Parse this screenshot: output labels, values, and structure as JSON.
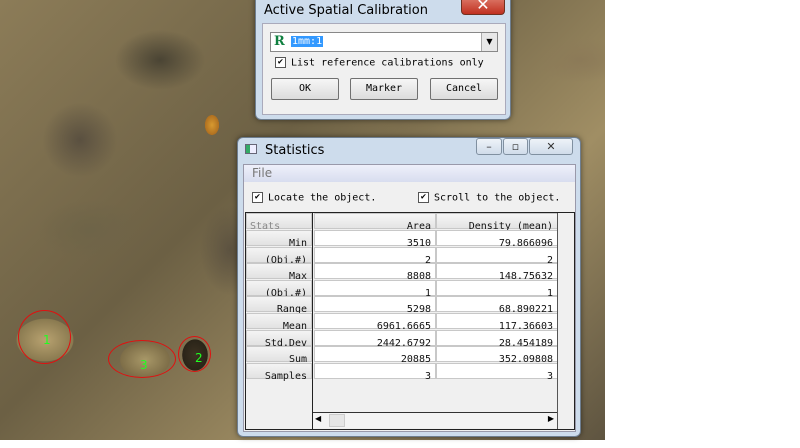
{
  "image": {
    "labels": [
      "1",
      "2",
      "3"
    ]
  },
  "calibration": {
    "title": "Active Spatial Calibration",
    "close_icon": "close-icon",
    "badge": "R",
    "selected": "1mm:1",
    "checkbox_label": "List reference calibrations only",
    "checked": true,
    "ok": "OK",
    "marker": "Marker",
    "cancel": "Cancel"
  },
  "statistics": {
    "title": "Statistics",
    "menu": [
      "File"
    ],
    "locate_label": "Locate the object.",
    "locate_checked": true,
    "scroll_label": "Scroll to the object.",
    "scroll_checked": true,
    "headers": [
      "Stats",
      "Area",
      "Density (mean)"
    ],
    "rows": [
      [
        "Min",
        "3510",
        "79.866096"
      ],
      [
        "(Obj.#)",
        "2",
        "2"
      ],
      [
        "Max",
        "8808",
        "148.75632"
      ],
      [
        "(Obj.#)",
        "1",
        "1"
      ],
      [
        "Range",
        "5298",
        "68.890221"
      ],
      [
        "Mean",
        "6961.6665",
        "117.36603"
      ],
      [
        "Std.Dev",
        "2442.6792",
        "28.454189"
      ],
      [
        "Sum",
        "20885",
        "352.09808"
      ],
      [
        "Samples",
        "3",
        "3"
      ]
    ]
  }
}
